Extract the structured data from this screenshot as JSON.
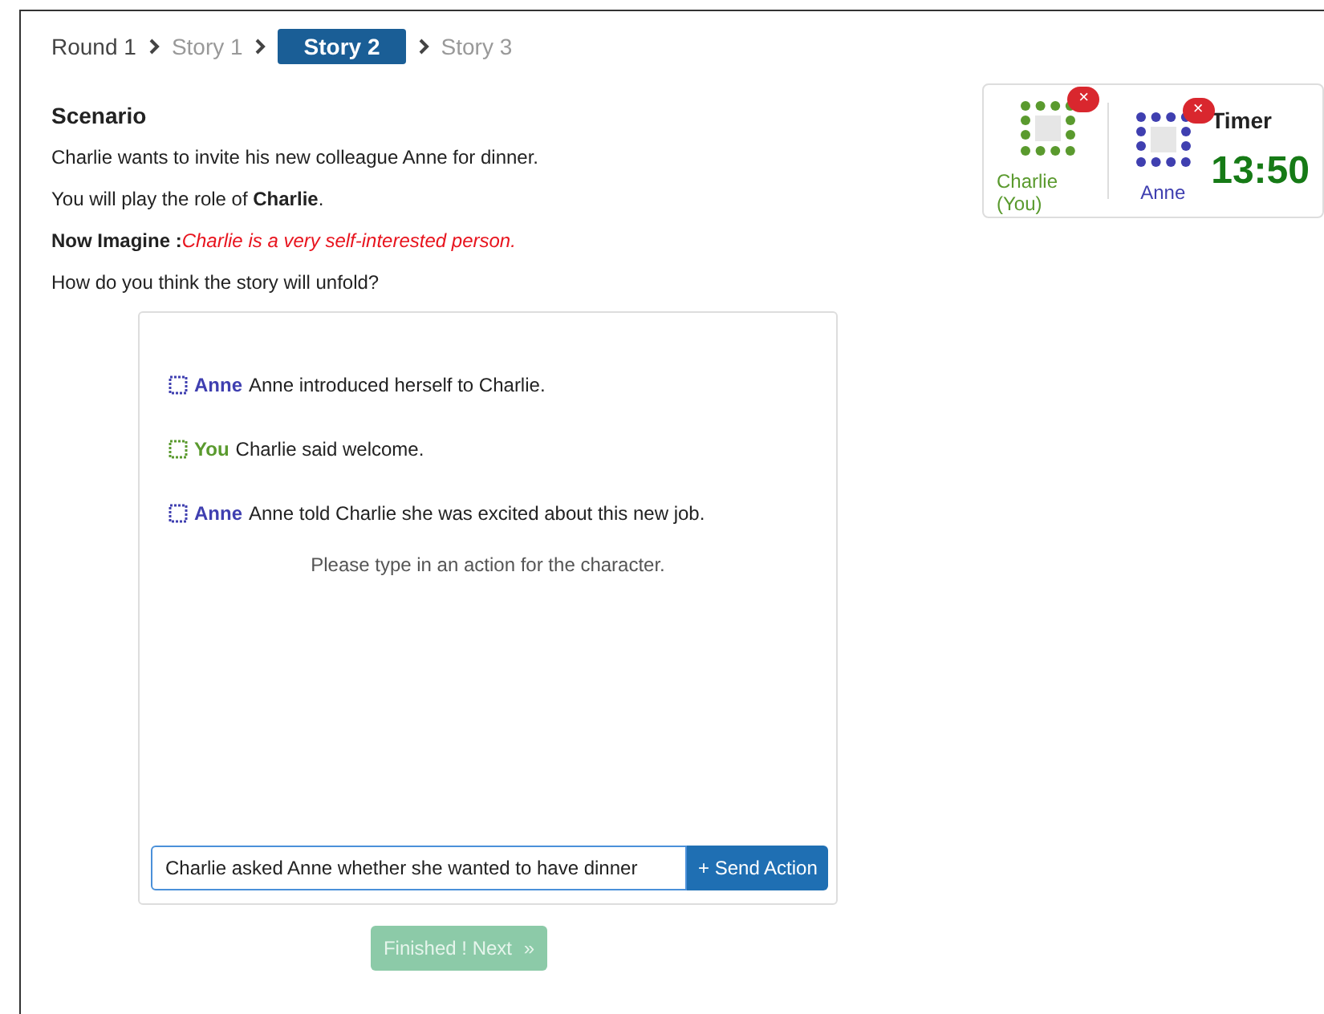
{
  "breadcrumb": {
    "round": "Round 1",
    "stories": [
      {
        "label": "Story 1",
        "selected": false
      },
      {
        "label": "Story 2",
        "selected": true
      },
      {
        "label": "Story 3",
        "selected": false
      }
    ]
  },
  "scenario": {
    "title": "Scenario",
    "lines": [
      "Charlie wants to invite his new colleague Anne for dinner.",
      "You will play the role of **Charlie**.",
      "**Now Imagine :**"
    ],
    "imagine": "Charlie is a very self-interested person.",
    "question": "How do you think the story will unfold?"
  },
  "messages": [
    {
      "speaker": "Anne",
      "color": "#3f3fb0",
      "text": "Anne introduced herself to Charlie."
    },
    {
      "speaker": "You",
      "color": "#5a9a2e",
      "text": "Charlie said welcome."
    },
    {
      "speaker": "Anne",
      "color": "#3f3fb0",
      "text": "Anne told Charlie she was excited about this new job."
    }
  ],
  "prompt": "Please type in an action for the character.",
  "action_input": {
    "value": "Charlie asked Anne whether she wanted to have dinner"
  },
  "send_button": "+ Send Action",
  "finish_button": {
    "label": "Finished ! Next",
    "icon": "»",
    "disabled": true
  },
  "players": [
    {
      "name": "Charlie (You)",
      "color": "#5a9a2e",
      "remove": "×"
    },
    {
      "name": "Anne",
      "color": "#3f3fb0",
      "remove": "×"
    }
  ],
  "timer": {
    "label": "Timer",
    "value": "13:50"
  }
}
